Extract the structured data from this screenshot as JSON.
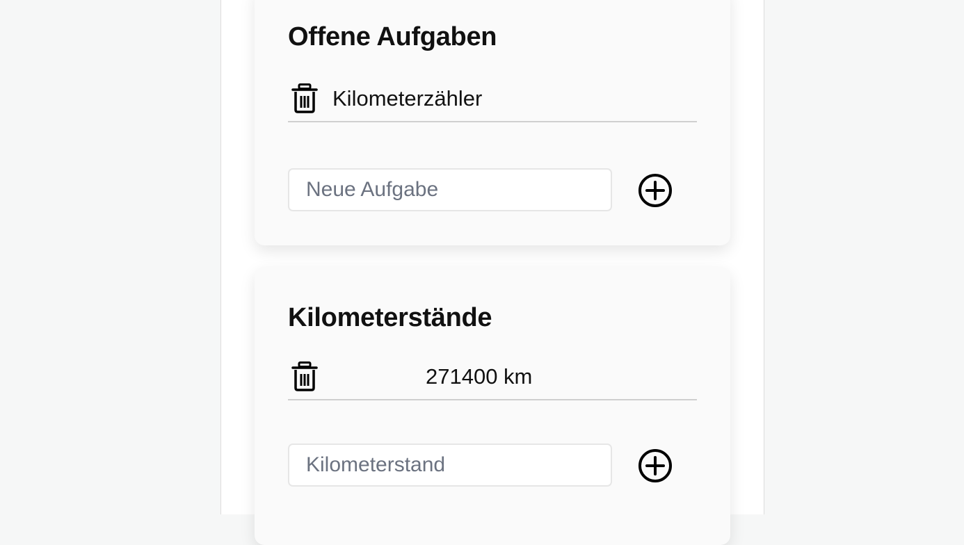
{
  "tasks": {
    "title": "Offene Aufgaben",
    "items": [
      {
        "label": "Kilometerzähler",
        "delete_icon": "trash-icon"
      }
    ],
    "new_input_placeholder": "Neue Aufgabe",
    "add_icon": "plus-circle-icon"
  },
  "mileage": {
    "title": "Kilometerstände",
    "items": [
      {
        "value": "271400 km",
        "delete_icon": "trash-icon"
      }
    ],
    "new_input_placeholder": "Kilometerstand",
    "add_icon": "plus-circle-icon"
  },
  "colors": {
    "page_background": "#f6f7f7",
    "column_background": "#ffffff",
    "card_background": "#fafafa",
    "text": "#111111",
    "placeholder": "#6b7280",
    "divider": "#cfcfcf"
  }
}
